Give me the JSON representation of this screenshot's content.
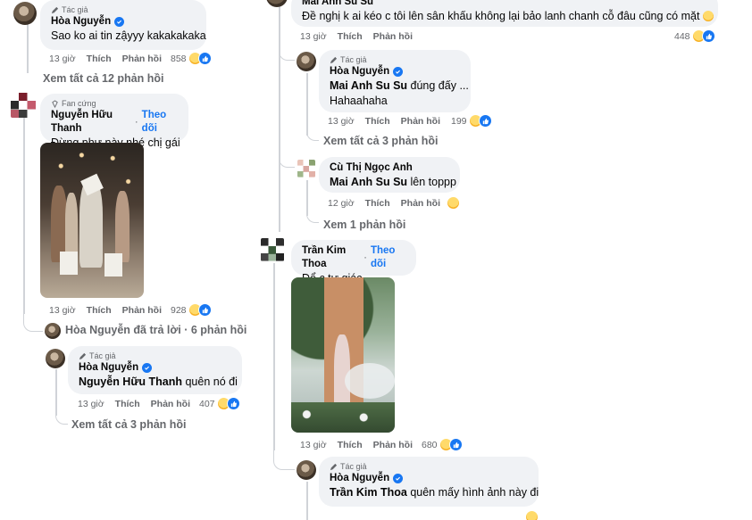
{
  "common": {
    "author_badge": "Tác giả",
    "fan_badge": "Fan cứng",
    "like": "Thích",
    "reply": "Phản hồi",
    "follow": "Theo dõi"
  },
  "left": {
    "top_comment": {
      "name": "Hòa Nguyễn",
      "text": "Sao ko ai tin zậyyy kakakakaka",
      "time": "13 giờ",
      "count": "858",
      "view_more": "Xem tất cả 12 phản hồi"
    },
    "thanh_comment": {
      "name": "Nguyễn Hữu Thanh",
      "text": "Đừng như này nhé chị gái",
      "time": "13 giờ",
      "count": "928"
    },
    "replied_summary": {
      "name": "Hòa Nguyễn",
      "text": "đã trả lời · 6 phản hồi"
    },
    "hoa_reply": {
      "name": "Hòa Nguyễn",
      "mention": "Nguyễn Hữu Thanh",
      "text": "quên nó đi",
      "time": "13 giờ",
      "count": "407",
      "view_more": "Xem tất cả 3 phản hồi"
    }
  },
  "right": {
    "top_comment": {
      "name": "Mai Anh Su Su",
      "text": "Đề nghị k ai kéo c tôi lên sân khấu không lại bảo lanh chanh cỗ đâu cũng có mặt",
      "time": "13 giờ",
      "count": "448"
    },
    "hoa_reply": {
      "name": "Hòa Nguyễn",
      "mention": "Mai Anh Su Su",
      "text": "đúng đấy ...",
      "text2": "Hahaahaha",
      "time": "13 giờ",
      "count": "199",
      "view_more": "Xem tất cả 3 phản hồi"
    },
    "cu_comment": {
      "name": "Cù Thị Ngọc Anh",
      "mention": "Mai Anh Su Su",
      "text": "lên toppp",
      "time": "12 giờ",
      "view_more": "Xem 1 phản hồi"
    },
    "thoa_comment": {
      "name": "Trần Kim Thoa",
      "text": "Để c tự giác",
      "time": "13 giờ",
      "count": "680"
    },
    "hoa_reply2": {
      "name": "Hòa Nguyễn",
      "mention": "Trần Kim Thoa",
      "text": "quên mấy hình ảnh này đi"
    }
  },
  "colors": {
    "bubble": "#f0f2f5",
    "link": "#1877f2",
    "secondary_text": "#65676b"
  }
}
